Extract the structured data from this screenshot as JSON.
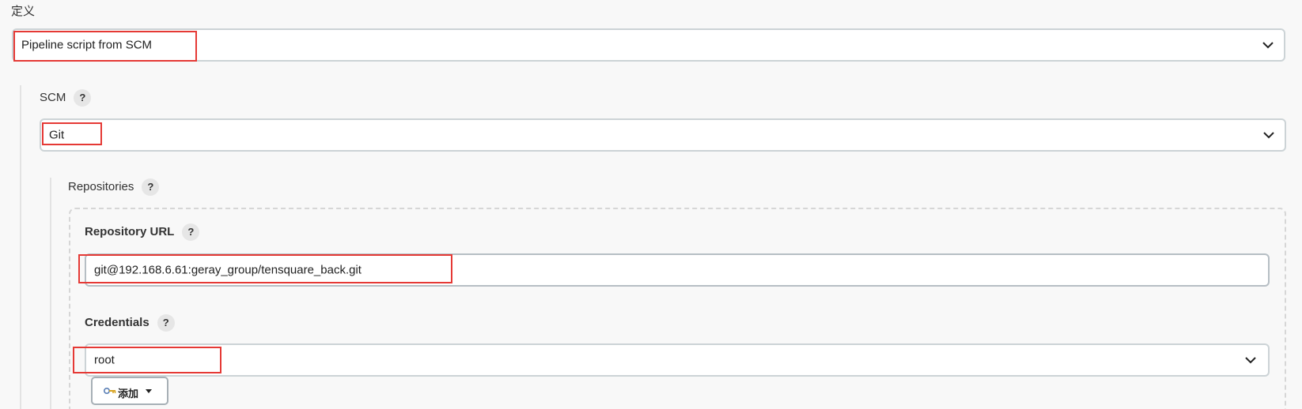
{
  "definition": {
    "label": "定义",
    "selected": "Pipeline script from SCM"
  },
  "scm": {
    "label": "SCM",
    "help": "?",
    "selected": "Git"
  },
  "repositories": {
    "label": "Repositories",
    "help": "?",
    "url_label": "Repository URL",
    "url_help": "?",
    "url_value": "git@192.168.6.61:geray_group/tensquare_back.git",
    "credentials_label": "Credentials",
    "credentials_help": "?",
    "credentials_selected": "root",
    "add_button_label": "添加"
  },
  "icons": {
    "dropdown": "chevron-down-icon",
    "help": "help-icon",
    "key": "key-icon",
    "caret": "caret-down-icon"
  },
  "colors": {
    "highlight": "#e53935",
    "background": "#f8f8f8"
  }
}
